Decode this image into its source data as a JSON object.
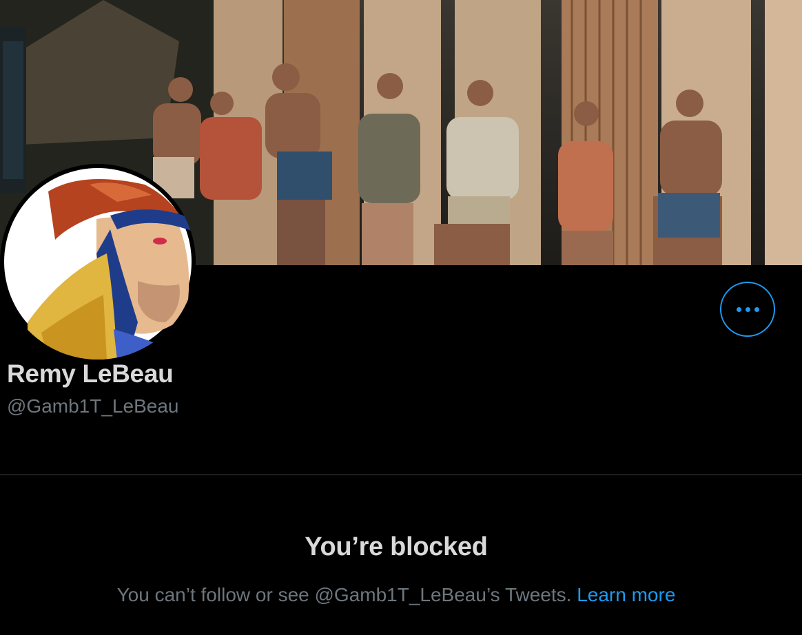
{
  "profile": {
    "display_name": "Remy LeBeau",
    "handle": "@Gamb1T_LeBeau",
    "banner_image": "vintage-beach-surfboards-photo",
    "avatar_image": "gambit-comic-avatar"
  },
  "actions": {
    "more_icon": "more-horizontal-icon"
  },
  "blocked": {
    "title": "You’re blocked",
    "message": "You can’t follow or see @Gamb1T_LeBeau’s Tweets.",
    "learn_more": "Learn more"
  },
  "colors": {
    "background": "#000000",
    "primary_text": "#d9d9d9",
    "secondary_text": "#6e767d",
    "accent": "#1d9bf0",
    "divider": "#3e4144"
  }
}
